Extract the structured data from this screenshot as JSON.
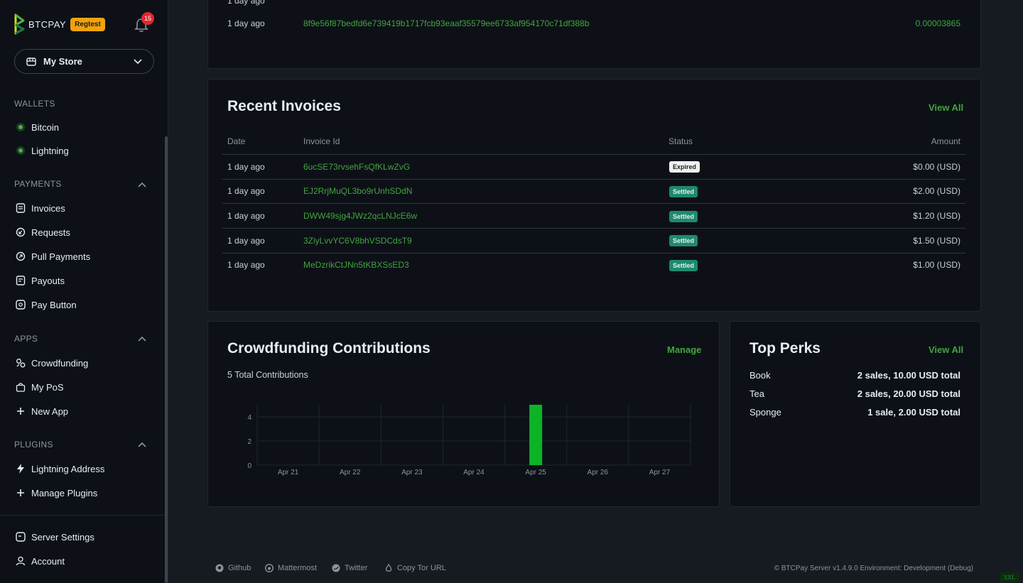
{
  "brand": {
    "name": "BTCPAY",
    "env_badge": "Regtest",
    "notifications": "15"
  },
  "store": {
    "name": "My Store"
  },
  "sidebar": {
    "wallets_title": "WALLETS",
    "wallets": [
      {
        "label": "Bitcoin"
      },
      {
        "label": "Lightning"
      }
    ],
    "payments_title": "PAYMENTS",
    "payments": [
      {
        "label": "Invoices"
      },
      {
        "label": "Requests"
      },
      {
        "label": "Pull Payments"
      },
      {
        "label": "Payouts"
      },
      {
        "label": "Pay Button"
      }
    ],
    "apps_title": "APPS",
    "apps": [
      {
        "label": "Crowdfunding"
      },
      {
        "label": "My PoS"
      },
      {
        "label": "New App"
      }
    ],
    "plugins_title": "PLUGINS",
    "plugins": [
      {
        "label": "Lightning Address"
      },
      {
        "label": "Manage Plugins"
      }
    ],
    "bottom": [
      {
        "label": "Server Settings"
      },
      {
        "label": "Account"
      }
    ]
  },
  "transactions": {
    "rows": [
      {
        "date": "1 day ago",
        "id": "8f9e56f87bedfd6e739419b1717fcb93eaaf35579ee6733af954170c71df388b",
        "amount": "0.00003865"
      }
    ]
  },
  "invoices": {
    "title": "Recent Invoices",
    "view_all": "View All",
    "columns": {
      "date": "Date",
      "id": "Invoice Id",
      "status": "Status",
      "amount": "Amount"
    },
    "rows": [
      {
        "date": "1 day ago",
        "id": "6ucSE73rvsehFsQfKLwZvG",
        "status": "Expired",
        "amount": "$0.00 (USD)"
      },
      {
        "date": "1 day ago",
        "id": "EJ2RrjMuQL3bo9rUnhSDdN",
        "status": "Settled",
        "amount": "$2.00 (USD)"
      },
      {
        "date": "1 day ago",
        "id": "DWW49sjg4JWz2qcLNJcE6w",
        "status": "Settled",
        "amount": "$1.20 (USD)"
      },
      {
        "date": "1 day ago",
        "id": "3ZiyLvvYC6V8bhVSDCdsT9",
        "status": "Settled",
        "amount": "$1.50 (USD)"
      },
      {
        "date": "1 day ago",
        "id": "MeDzrikCtJNn5tKBXSsED3",
        "status": "Settled",
        "amount": "$1.00 (USD)"
      }
    ]
  },
  "crowdfunding": {
    "title": "Crowdfunding Contributions",
    "manage": "Manage",
    "total": "5 Total Contributions"
  },
  "chart_data": {
    "type": "bar",
    "categories": [
      "Apr 21",
      "Apr 22",
      "Apr 23",
      "Apr 24",
      "Apr 25",
      "Apr 26",
      "Apr 27"
    ],
    "values": [
      0,
      0,
      0,
      0,
      5,
      0,
      0
    ],
    "yticks": [
      0,
      2,
      4
    ],
    "ylim": [
      0,
      5
    ],
    "bar_color": "#0cb324",
    "grid": true
  },
  "perks": {
    "title": "Top Perks",
    "view_all": "View All",
    "rows": [
      {
        "name": "Book",
        "value": "2 sales, 10.00 USD total"
      },
      {
        "name": "Tea",
        "value": "2 sales, 20.00 USD total"
      },
      {
        "name": "Sponge",
        "value": "1 sale, 2.00 USD total"
      }
    ]
  },
  "footer": {
    "links": [
      "Github",
      "Mattermost",
      "Twitter",
      "Copy Tor URL"
    ],
    "copyright": "© BTCPay Server v1.4.9.0 Environment: Development (Debug)",
    "breakpoint": "XXL"
  },
  "colors": {
    "accent": "#44a340",
    "settled": "#1e8a6e",
    "badge_red": "#e5262f",
    "regtest": "#f0a30a"
  }
}
